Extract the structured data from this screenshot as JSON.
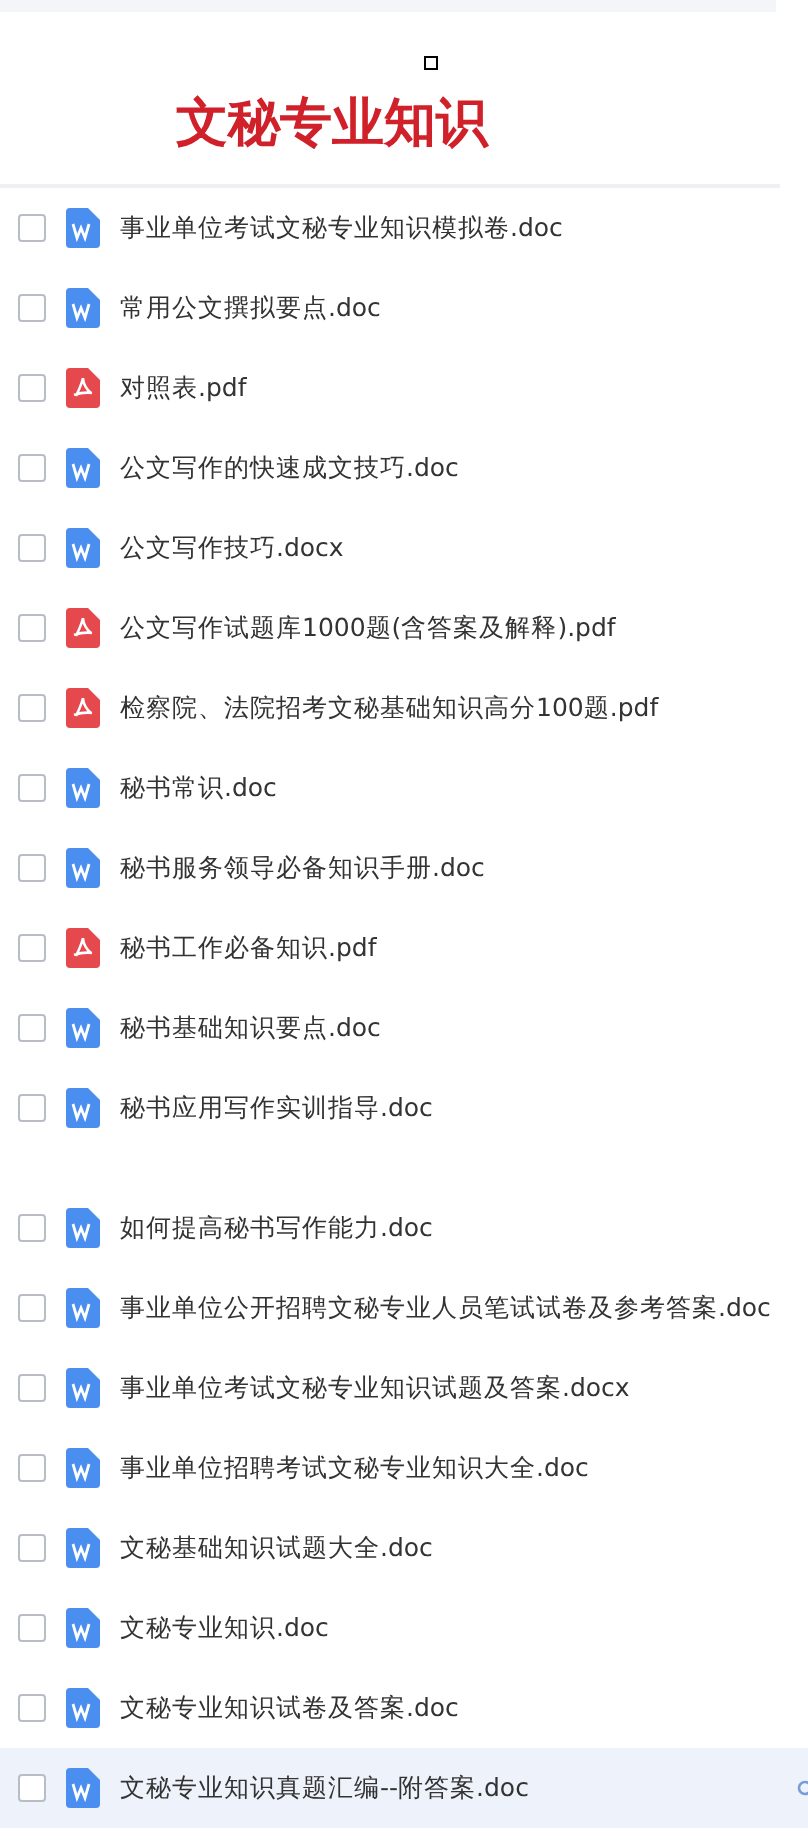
{
  "title": "文秘专业知识",
  "files": [
    {
      "name": "事业单位考试文秘专业知识模拟卷.doc",
      "kind": "word",
      "highlighted": false
    },
    {
      "name": "常用公文撰拟要点.doc",
      "kind": "word",
      "highlighted": false
    },
    {
      "name": "对照表.pdf",
      "kind": "pdf",
      "highlighted": false
    },
    {
      "name": "公文写作的快速成文技巧.doc",
      "kind": "word",
      "highlighted": false
    },
    {
      "name": "公文写作技巧.docx",
      "kind": "word",
      "highlighted": false
    },
    {
      "name": "公文写作试题库1000题(含答案及解释).pdf",
      "kind": "pdf",
      "highlighted": false
    },
    {
      "name": "检察院、法院招考文秘基础知识高分100题.pdf",
      "kind": "pdf",
      "highlighted": false
    },
    {
      "name": "秘书常识.doc",
      "kind": "word",
      "highlighted": false
    },
    {
      "name": "秘书服务领导必备知识手册.doc",
      "kind": "word",
      "highlighted": false
    },
    {
      "name": "秘书工作必备知识.pdf",
      "kind": "pdf",
      "highlighted": false
    },
    {
      "name": "秘书基础知识要点.doc",
      "kind": "word",
      "highlighted": false
    },
    {
      "name": "秘书应用写作实训指导.doc",
      "kind": "word",
      "highlighted": false
    }
  ],
  "files_continued": [
    {
      "name": "如何提高秘书写作能力.doc",
      "kind": "word",
      "highlighted": false
    },
    {
      "name": "事业单位公开招聘文秘专业人员笔试试卷及参考答案.doc",
      "kind": "word",
      "highlighted": false
    },
    {
      "name": "事业单位考试文秘专业知识试题及答案.docx",
      "kind": "word",
      "highlighted": false
    },
    {
      "name": "事业单位招聘考试文秘专业知识大全.doc",
      "kind": "word",
      "highlighted": false
    },
    {
      "name": "文秘基础知识试题大全.doc",
      "kind": "word",
      "highlighted": false
    },
    {
      "name": "文秘专业知识.doc",
      "kind": "word",
      "highlighted": false
    },
    {
      "name": "文秘专业知识试卷及答案.doc",
      "kind": "word",
      "highlighted": false
    },
    {
      "name": "文秘专业知识真题汇编--附答案.doc",
      "kind": "word",
      "highlighted": true
    }
  ]
}
